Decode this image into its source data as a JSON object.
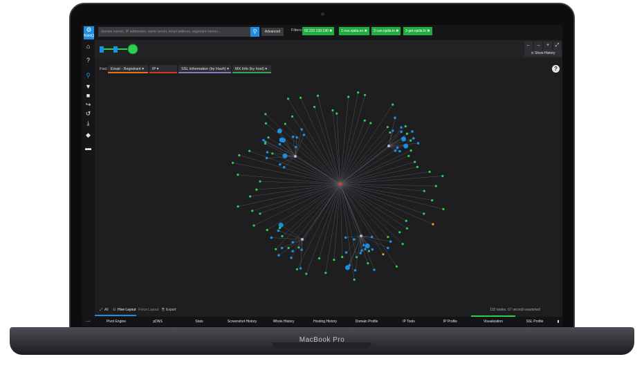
{
  "device": {
    "brand": "MacBook Pro"
  },
  "app": {
    "logo_text": "RiskIQ",
    "search": {
      "placeholder": "domain names, IP addresses, name server, email address, registrant names..."
    },
    "advanced_label": "Advanced",
    "filters_label": "Filters:",
    "filters": [
      "92.222.139.190 ✖",
      "1-vos.njalla.no ✖",
      "2-can.njalla.in ✖",
      "3-get.njalla.fo ✖"
    ],
    "show_history_label": "⊙ Show History",
    "focus_label": "Foci:",
    "focus_selects": [
      {
        "label": "Email - Registrant ▾",
        "color": "#e0761f"
      },
      {
        "label": "IP ▾",
        "color": "#d23a2c"
      },
      {
        "label": "SSL Information (by Hash) ▾",
        "color": "#8b78c8"
      },
      {
        "label": "MX Info (by host) ▾",
        "color": "#2fa84e"
      }
    ],
    "help_label": "?",
    "layout_bar": {
      "all_label": "All",
      "hive_label": "Hive Layout",
      "force_label": "Force Layout",
      "export_label": "Export"
    },
    "node_count_text": "132 nodes. 67 records examined",
    "tabs": [
      "Pivot Engine",
      "pDNS",
      "Stats",
      "Screenshot History",
      "Whois History",
      "Hosting History",
      "Domain Profile",
      "IP Tools",
      "IP Profile",
      "Visualization",
      "SSL Profile"
    ],
    "active_tab": "Visualization",
    "colors": {
      "green": "#2ed14f",
      "blue": "#1c8fe0",
      "red": "#e23b2b",
      "orange": "#f0a020",
      "lavender": "#b8b4e0"
    }
  }
}
